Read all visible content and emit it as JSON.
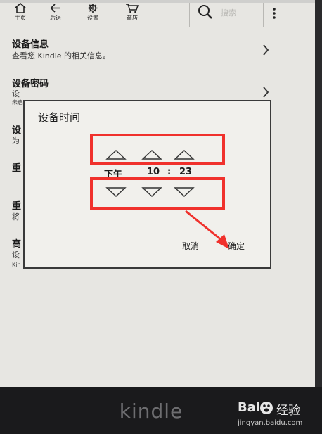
{
  "toolbar": {
    "home_label": "主页",
    "back_label": "后退",
    "settings_label": "设置",
    "store_label": "商店",
    "search_placeholder": "搜索"
  },
  "settings_list": {
    "items": [
      {
        "title": "设备信息",
        "subtitle": "查看您 Kindle 的相关信息。"
      },
      {
        "title": "设备密码",
        "subtitle": "设",
        "note": "未启"
      },
      {
        "title": "设",
        "subtitle": "为"
      },
      {
        "title": "重"
      },
      {
        "title": "重",
        "subtitle": "将"
      },
      {
        "title": "高",
        "subtitle": "设",
        "note": "Kin"
      }
    ]
  },
  "dialog": {
    "title": "设备时间",
    "period": "下午",
    "hour": "10",
    "separator": ":",
    "minute": "23",
    "cancel_label": "取消",
    "ok_label": "确定"
  },
  "device": {
    "brand": "kindle"
  },
  "watermark": {
    "logo_left": "Bai",
    "logo_right": "经验",
    "url": "jingyan.baidu.com"
  },
  "colors": {
    "highlight": "#f0312c",
    "screen": "#e7e6e2",
    "bezel": "#1a1a1c"
  }
}
